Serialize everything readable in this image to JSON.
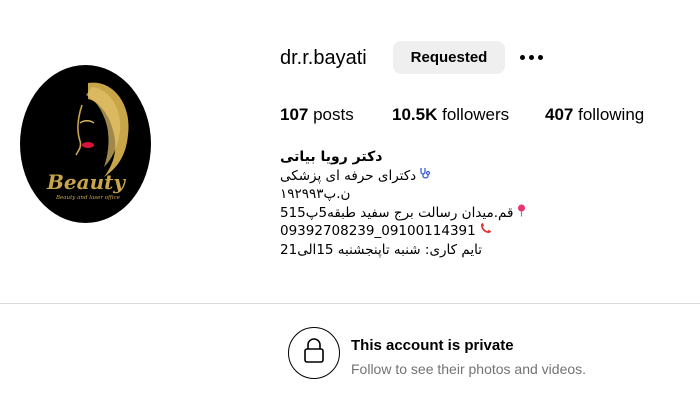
{
  "profile": {
    "username": "dr.r.bayati",
    "follow_button_label": "Requested",
    "avatar_text": "Beauty",
    "avatar_subtext": "Beauty and laser office"
  },
  "stats": {
    "posts_count": "107",
    "posts_label": " posts",
    "followers_count": "10.5K",
    "followers_label": " followers",
    "following_count": "407",
    "following_label": " following"
  },
  "bio": {
    "name": "دکتر رویا بیاتی",
    "line1": "دکترای حرفه ای پزشکی",
    "line2": "ن.پ۱۹۲۹۹۳",
    "line3": "قم.میدان رسالت برج سفید طبقه5پ515",
    "line4": "09392708239_09100114391",
    "line5": "تایم کاری: شنبه تاپنجشنبه 15الی21"
  },
  "private": {
    "title": "This account is private",
    "subtitle": "Follow to see their photos and videos."
  },
  "colors": {
    "button_bg": "#efefef",
    "secondary_text": "#737373",
    "divider": "#dbdbdb",
    "avatar_gold": "#c9a54a"
  },
  "icons": {
    "more": "more-options-icon",
    "stethoscope": "stethoscope-icon",
    "pin": "location-pin-icon",
    "phone": "phone-icon",
    "lock": "lock-icon"
  }
}
